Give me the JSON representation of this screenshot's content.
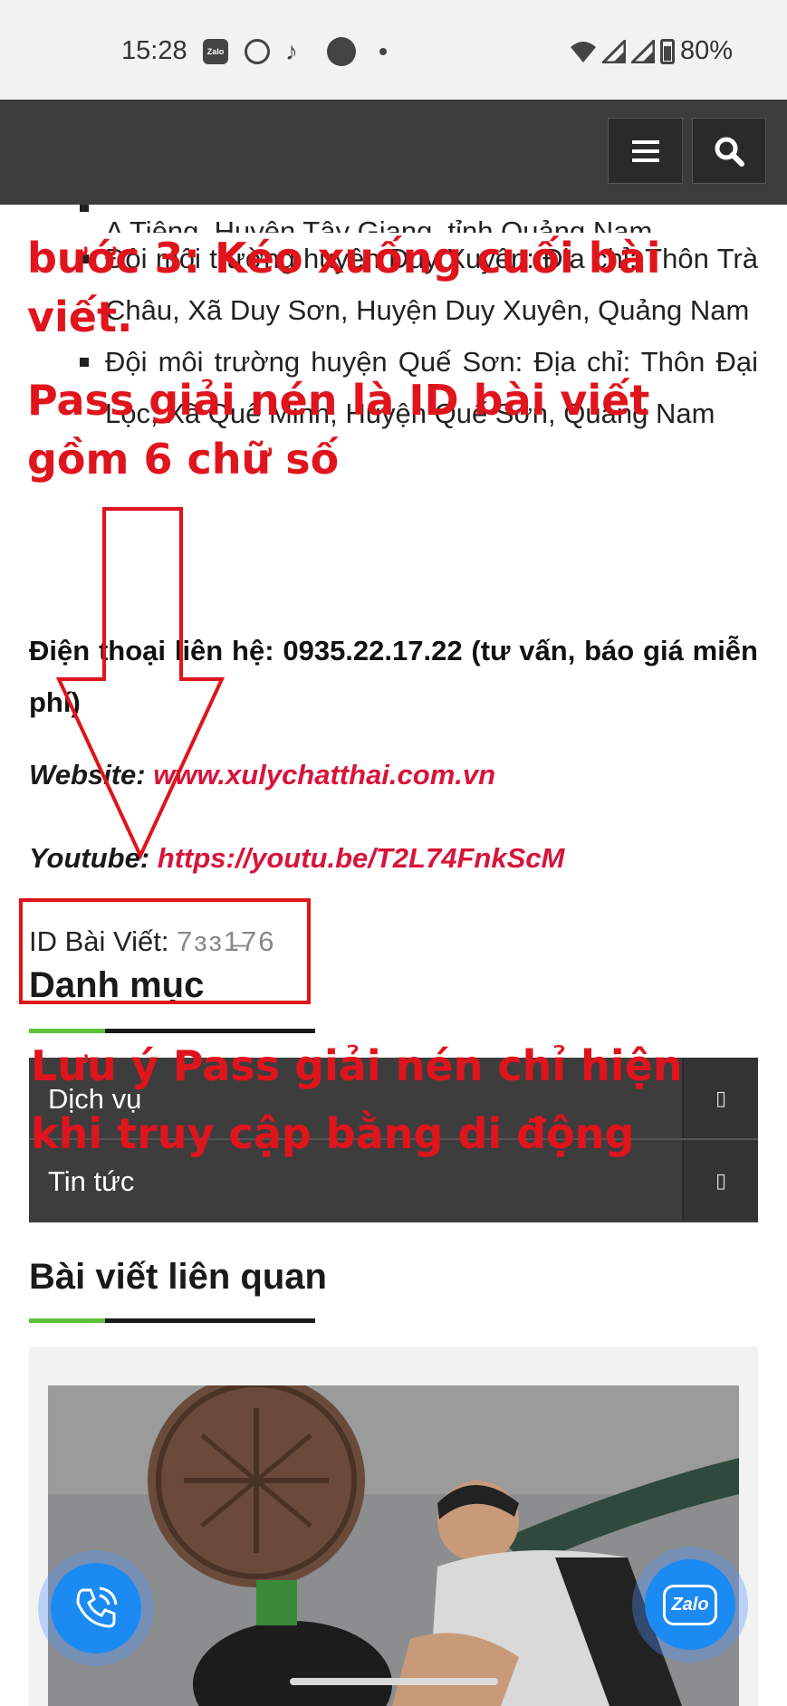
{
  "status_bar": {
    "time": "15:28",
    "app_icons": [
      "zalo-icon",
      "sport-icon",
      "tiktok-icon",
      "record-icon"
    ],
    "zalo_label": "Zalo",
    "battery": "80%"
  },
  "nav": {
    "menu_icon": "hamburger-icon",
    "search_icon": "search-icon"
  },
  "article": {
    "bullets": [
      "Đội môi trường huyện Tây Giang: Thôn Agrong, xã A Tiêng, Huyện Tây Giang, tỉnh Quảng Nam",
      "Đội môi trường huyện Duy Xuyên: Địa chỉ: Thôn Trà Châu, Xã Duy Sơn, Huyện Duy Xuyên, Quảng Nam",
      "Đội môi trường huyện Quế Sơn: Địa chỉ: Thôn Đại Lộc, Xã Quế Minh, Huyện Quế Sơn, Quảng Nam"
    ],
    "phone": "Điện thoại liên hệ: 0935.22.17.22 (tư vấn, báo giá miễn phí)",
    "website_label": "Website: ",
    "website_link": "www.xulychatthai.com.vn",
    "youtube_label": "Youtube: ",
    "youtube_link": "https://youtu.be/T2L74FnkScM",
    "id_label": "ID Bài Viết: ",
    "id_value": "7ɜɜ1̶76"
  },
  "categories": {
    "title": "Danh mục",
    "items": [
      {
        "label": "Dịch vụ",
        "toggle": "▯"
      },
      {
        "label": "Tin tức",
        "toggle": "▯"
      }
    ]
  },
  "related": {
    "title": "Bài viết liên quan"
  },
  "annotations": {
    "step": "bước 3: Kéo xuống cuối bài viết.",
    "pass": "Pass giải nén là ID bài viết gồm 6 chữ số",
    "note": "Lưu ý Pass giải nén chỉ hiện khi truy cập bằng di động"
  },
  "fab": {
    "call_icon": "phone-icon",
    "zalo_label": "Zalo"
  },
  "colors": {
    "annotation_red": "#e0141c",
    "link_red": "#d7143a",
    "nav_bg": "#3c3c3c",
    "accent_green": "#5ec13b",
    "fab_blue": "#1b8af2"
  }
}
